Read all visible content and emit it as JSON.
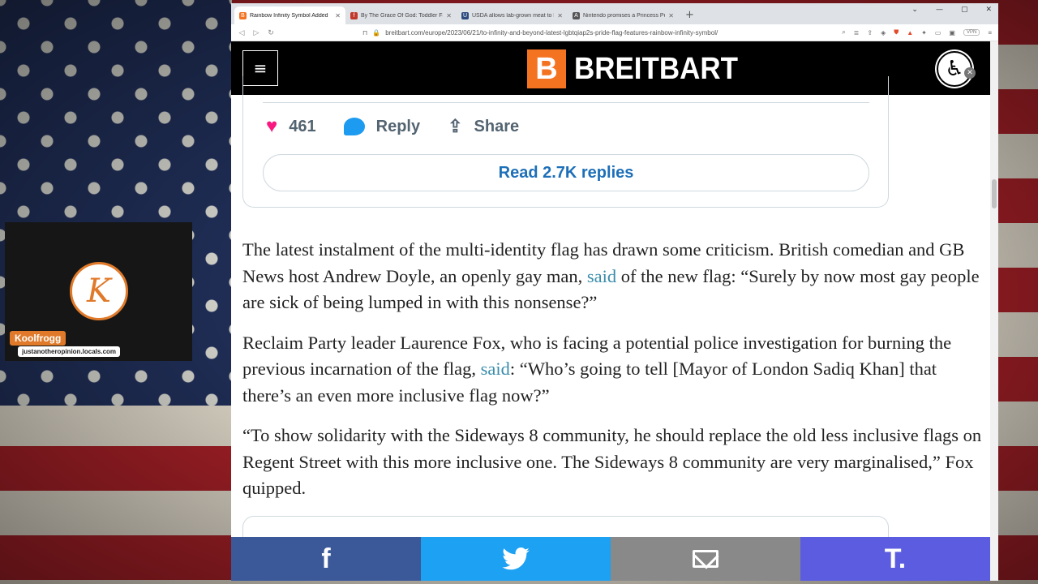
{
  "streamer": {
    "logo_letter": "K",
    "name": "Koolfrogg",
    "url": "justanotheropinion.locals.com"
  },
  "browser": {
    "tabs": [
      {
        "label": "Rainbow Infinity Symbol Added",
        "favicon": "B",
        "color": "#f47321",
        "active": true
      },
      {
        "label": "By The Grace Of God: Toddler Falls",
        "favicon": "f",
        "color": "#c0392b",
        "active": false
      },
      {
        "label": "USDA allows lab-grown meat to be sold",
        "favicon": "U",
        "color": "#2c4a7e",
        "active": false
      },
      {
        "label": "Nintendo promises a Princess Peach",
        "favicon": "A",
        "color": "#555555",
        "active": false
      }
    ],
    "new_tab": "+",
    "url": "breitbart.com/europe/2023/06/21/to-infinity-and-beyond-latest-lgbtqiap2s-pride-flag-features-rainbow-infinity-symbol/",
    "vpn_label": "VPN"
  },
  "site": {
    "menu_icon": "≡",
    "brand_letter": "B",
    "brand_name": "BREITBART",
    "accent": "#f47321"
  },
  "tweet": {
    "likes": "461",
    "reply_label": "Reply",
    "share_label": "Share",
    "read_replies_label": "Read 2.7K replies"
  },
  "article": {
    "p1_a": "The latest instalment of the multi-identity flag has drawn some criticism. British comedian and GB News host Andrew Doyle, an openly gay man, ",
    "p1_link": "said",
    "p1_b": " of the new flag: “Surely by now most gay people are sick of being lumped in with this nonsense?”",
    "p2_a": "Reclaim Party leader Laurence Fox, who is facing a potential police investigation for burning the previous incarnation of the flag, ",
    "p2_link": "said",
    "p2_b": ": “Who’s going to tell [Mayor of London Sadiq Khan] that there’s an even more inclusive flag now?”",
    "p3": "“To show solidarity with the Sideways 8 community, he should replace the old less inclusive flags on Regent Street with this more inclusive one. The Sideways 8 community are very marginalised,” Fox quipped."
  },
  "sharebar": {
    "facebook": "f",
    "truth": "T."
  }
}
